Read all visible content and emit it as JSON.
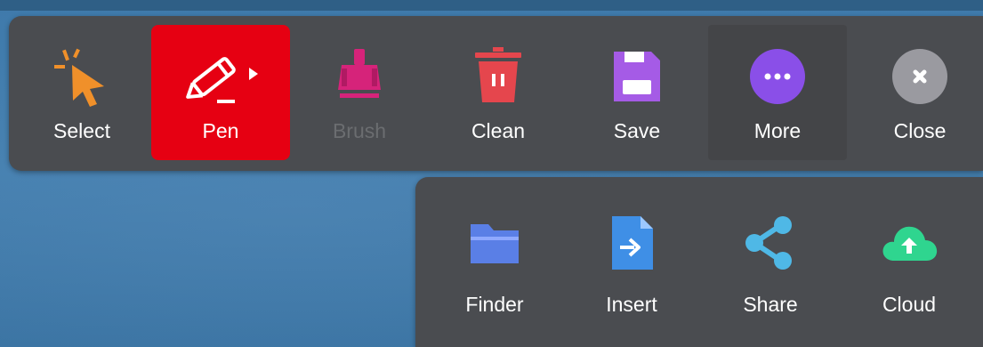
{
  "toolbar": {
    "items": [
      {
        "label": "Select",
        "icon": "select-cursor-icon",
        "color": "#f0902a"
      },
      {
        "label": "Pen",
        "icon": "pen-icon",
        "active": true,
        "active_color": "#e60012"
      },
      {
        "label": "Brush",
        "icon": "brush-icon",
        "disabled": true,
        "color": "#d6237a"
      },
      {
        "label": "Clean",
        "icon": "trash-icon",
        "color": "#e5464d"
      },
      {
        "label": "Save",
        "icon": "floppy-disk-icon",
        "color": "#a55be6"
      },
      {
        "label": "More",
        "icon": "more-dots-icon",
        "color": "#8a4fe8"
      },
      {
        "label": "Close",
        "icon": "close-icon",
        "color": "#9a9aa0"
      }
    ]
  },
  "more_panel": {
    "items": [
      {
        "label": "Finder",
        "icon": "folder-icon",
        "color": "#5a7fe6"
      },
      {
        "label": "Insert",
        "icon": "insert-file-icon",
        "color": "#3f8fe6"
      },
      {
        "label": "Share",
        "icon": "share-icon",
        "color": "#4fb8e6"
      },
      {
        "label": "Cloud",
        "icon": "cloud-upload-icon",
        "color": "#2fd58f"
      }
    ]
  }
}
